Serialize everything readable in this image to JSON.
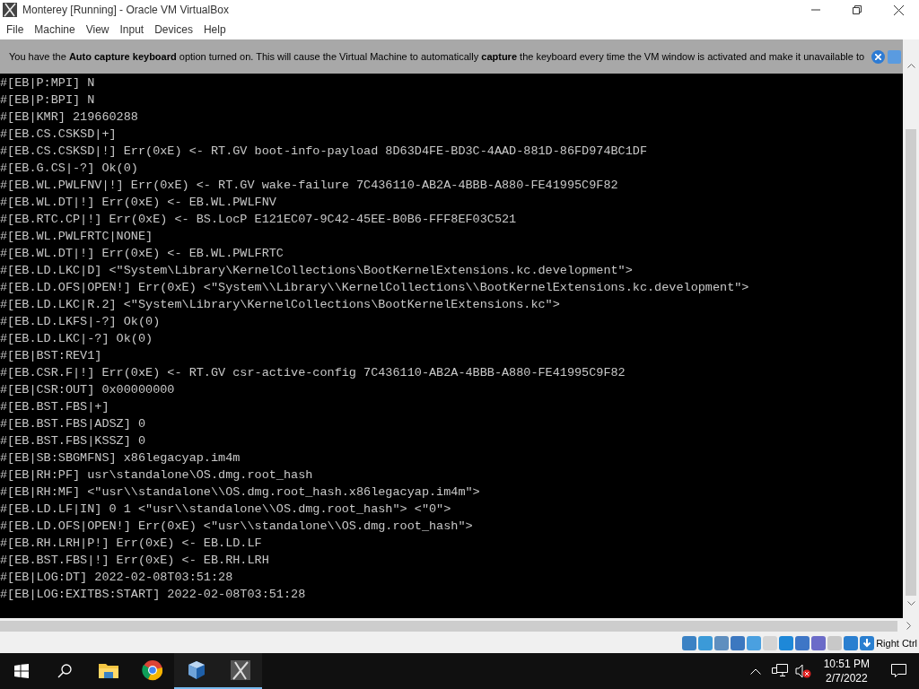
{
  "window": {
    "title": "Monterey [Running] - Oracle VM VirtualBox"
  },
  "menu": [
    "File",
    "Machine",
    "View",
    "Input",
    "Devices",
    "Help"
  ],
  "banner": {
    "text": "You have the **Auto capture keyboard** option turned on. This will cause the Virtual Machine to automatically **capture** the keyboard every time the VM window is activated and make it unavailable to"
  },
  "console": [
    "#[EB|P:MPI] N",
    "#[EB|P:BPI] N",
    "#[EB|KMR] 219660288",
    "#[EB.CS.CSKSD|+]",
    "#[EB.CS.CSKSD|!] Err(0xE) <- RT.GV boot-info-payload 8D63D4FE-BD3C-4AAD-881D-86FD974BC1DF",
    "#[EB.G.CS|-?] Ok(0)",
    "#[EB.WL.PWLFNV|!] Err(0xE) <- RT.GV wake-failure 7C436110-AB2A-4BBB-A880-FE41995C9F82",
    "#[EB.WL.DT|!] Err(0xE) <- EB.WL.PWLFNV",
    "#[EB.RTC.CP|!] Err(0xE) <- BS.LocP E121EC07-9C42-45EE-B0B6-FFF8EF03C521",
    "#[EB.WL.PWLFRTC|NONE]",
    "#[EB.WL.DT|!] Err(0xE) <- EB.WL.PWLFRTC",
    "#[EB.LD.LKC|D] <\"System\\Library\\KernelCollections\\BootKernelExtensions.kc.development\">",
    "#[EB.LD.OFS|OPEN!] Err(0xE) <\"System\\\\Library\\\\KernelCollections\\\\BootKernelExtensions.kc.development\">",
    "#[EB.LD.LKC|R.2] <\"System\\Library\\KernelCollections\\BootKernelExtensions.kc\">",
    "#[EB.LD.LKFS|-?] Ok(0)",
    "#[EB.LD.LKC|-?] Ok(0)",
    "#[EB|BST:REV1]",
    "#[EB.CSR.F|!] Err(0xE) <- RT.GV csr-active-config 7C436110-AB2A-4BBB-A880-FE41995C9F82",
    "#[EB|CSR:OUT] 0x00000000",
    "#[EB.BST.FBS|+]",
    "#[EB.BST.FBS|ADSZ] 0",
    "#[EB.BST.FBS|KSSZ] 0",
    "#[EB|SB:SBGMFNS] x86legacyap.im4m",
    "#[EB|RH:PF] usr\\standalone\\OS.dmg.root_hash",
    "#[EB|RH:MF] <\"usr\\\\standalone\\\\OS.dmg.root_hash.x86legacyap.im4m\">",
    "#[EB.LD.LF|IN] 0 1 <\"usr\\\\standalone\\\\OS.dmg.root_hash\"> <\"0\">",
    "#[EB.LD.OFS|OPEN!] Err(0xE) <\"usr\\\\standalone\\\\OS.dmg.root_hash\">",
    "#[EB.RH.LRH|P!] Err(0xE) <- EB.LD.LF",
    "#[EB.BST.FBS|!] Err(0xE) <- EB.RH.LRH",
    "#[EB|LOG:DT] 2022-02-08T03:51:28",
    "#[EB|LOG:EXITBS:START] 2022-02-08T03:51:28"
  ],
  "status_bar": {
    "host_key": "Right Ctrl"
  },
  "taskbar": {
    "apps": [
      {
        "kind": "explorer",
        "open": false
      },
      {
        "kind": "chrome",
        "open": false
      },
      {
        "kind": "virtualbox",
        "open": true
      },
      {
        "kind": "terminal",
        "open": true
      }
    ],
    "time": "10:51 PM",
    "date": "2/7/2022"
  }
}
